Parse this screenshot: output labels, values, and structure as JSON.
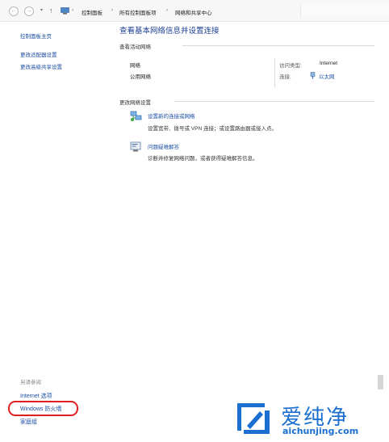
{
  "address_bar": {
    "back_glyph": "←",
    "forward_glyph": "→",
    "dropdown_glyph": "▾",
    "up_glyph": "↑",
    "separator_glyph": "›",
    "breadcrumbs": [
      "控制面板",
      "所有控制面板项",
      "网络和共享中心"
    ]
  },
  "sidebar": {
    "items": [
      "控制面板主页",
      "更改适配器设置",
      "更改高级共享设置"
    ],
    "see_also_heading": "另请参阅",
    "see_also": [
      "Internet 选项",
      "Windows 防火墙",
      "家庭组"
    ]
  },
  "main": {
    "title": "查看基本网络信息并设置连接",
    "active_networks_heading": "查看活动网络",
    "network": {
      "name": "网络",
      "type": "公用网络",
      "access_type_label": "访问类型:",
      "access_type_value": "Internet",
      "connection_label": "连接:",
      "connection_value": "以太网"
    },
    "change_settings_heading": "更改网络设置",
    "tasks": [
      {
        "link": "设置新的连接或网络",
        "description": "设置宽带、拨号或 VPN 连接；或设置路由器或接入点。",
        "icon": "network-setup-icon"
      },
      {
        "link": "问题疑难解答",
        "description": "诊断并修复网络问题，或者获得疑难解答信息。",
        "icon": "troubleshoot-icon"
      }
    ]
  },
  "watermark": {
    "brand": "爱纯净",
    "url": "aichunjing.com",
    "color": "#1a6fd0"
  },
  "colors": {
    "link": "#1b4ea3",
    "title": "#1c3f94",
    "highlight_ring": "#e02020"
  }
}
